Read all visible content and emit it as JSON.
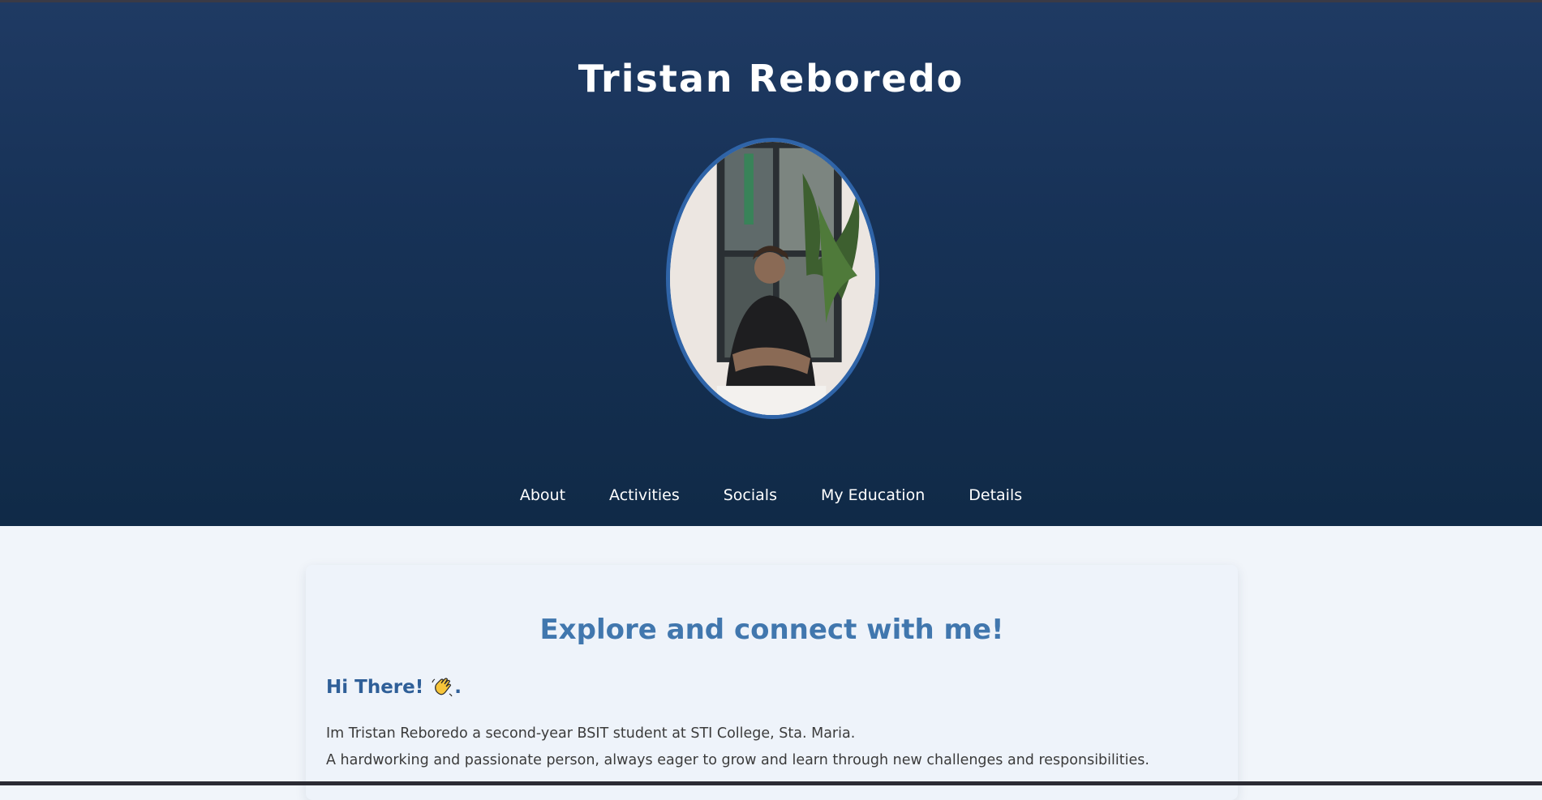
{
  "header": {
    "title": "Tristan Reboredo"
  },
  "nav": {
    "items": [
      "About",
      "Activities",
      "Socials",
      "My Education",
      "Details"
    ]
  },
  "intro": {
    "heading": "Explore and connect with me!",
    "greeting": "Hi There!",
    "greeting_suffix": ".",
    "line1": "Im Tristan Reboredo a second-year BSIT student at STI College, Sta. Maria.",
    "line2": "A hardworking and passionate person, always eager to grow and learn through new challenges and responsibilities."
  },
  "colors": {
    "hero_top": "#1f3a63",
    "hero_bottom": "#102a47",
    "accent": "#4177ae",
    "portrait_border": "#2f64a8"
  },
  "icons": {
    "greeting": "waving-hand-icon"
  }
}
